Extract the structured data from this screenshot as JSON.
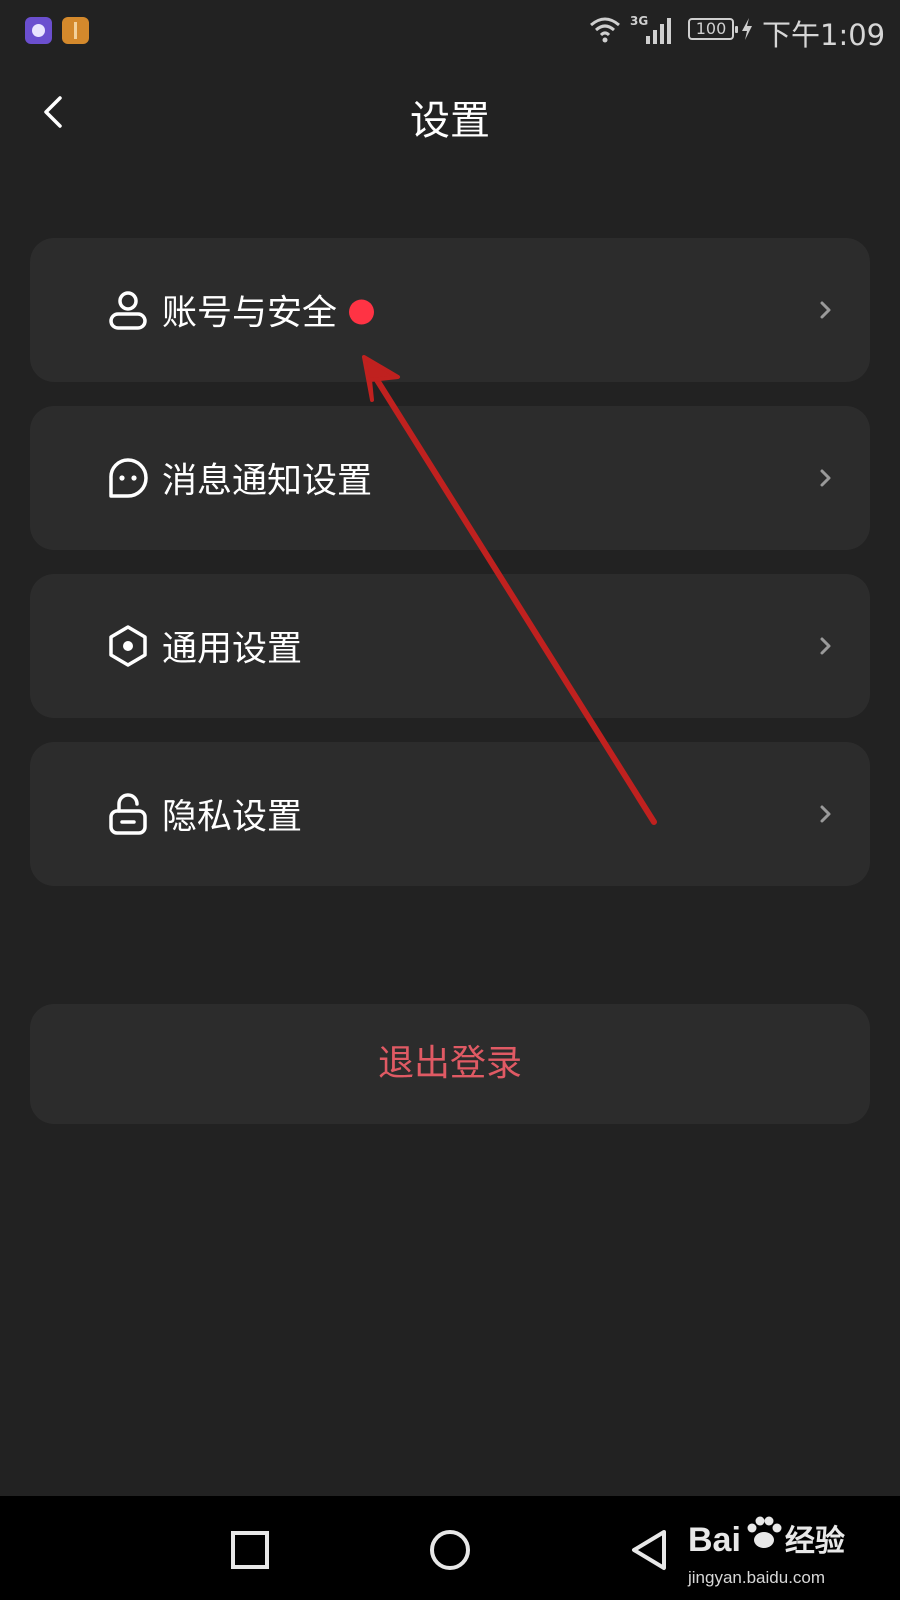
{
  "status_bar": {
    "network": "3G",
    "battery": "100",
    "time": "下午1:09",
    "app_icons": [
      "app-notification-icon-purple",
      "app-notification-icon-orange"
    ]
  },
  "header": {
    "title": "设置",
    "back_icon": "chevron-left-icon"
  },
  "menu": {
    "items": [
      {
        "label": "账号与安全",
        "icon": "user-icon",
        "badge": "red-dot"
      },
      {
        "label": "消息通知设置",
        "icon": "chat-bubble-icon"
      },
      {
        "label": "通用设置",
        "icon": "hexagon-gear-icon"
      },
      {
        "label": "隐私设置",
        "icon": "lock-icon"
      }
    ]
  },
  "logout": {
    "label": "退出登录"
  },
  "watermark": {
    "logo_text": "Bai",
    "logo_suffix": "经验",
    "url": "jingyan.baidu.com"
  },
  "colors": {
    "background": "#222222",
    "card": "#2c2c2c",
    "logout_text": "#e05a64",
    "badge": "#ff3344",
    "annotation_arrow": "#c0211f"
  }
}
